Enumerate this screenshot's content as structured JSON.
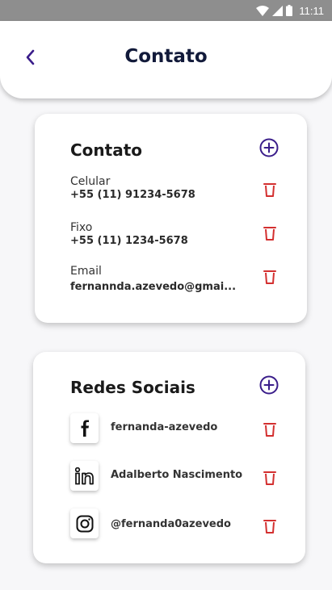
{
  "status_bar": {
    "time": "11:11"
  },
  "header": {
    "title": "Contato"
  },
  "contact_card": {
    "title": "Contato",
    "items": [
      {
        "type": "Celular",
        "value": "+55 (11) 91234-5678"
      },
      {
        "type": "Fixo",
        "value": "+55 (11) 1234-5678"
      },
      {
        "type": "Email",
        "value": "fernannda.azevedo@gmai..."
      }
    ]
  },
  "social_card": {
    "title": "Redes Sociais",
    "items": [
      {
        "network": "facebook-icon",
        "handle": "fernanda-azevedo"
      },
      {
        "network": "linkedin-icon",
        "handle": "Adalberto Nascimento"
      },
      {
        "network": "instagram-icon",
        "handle": "@fernanda0azevedo"
      }
    ]
  },
  "colors": {
    "accent": "#3a1d8a",
    "delete": "#d32f2f",
    "title": "#121a3a",
    "status_bar": "#8e8e8e"
  }
}
